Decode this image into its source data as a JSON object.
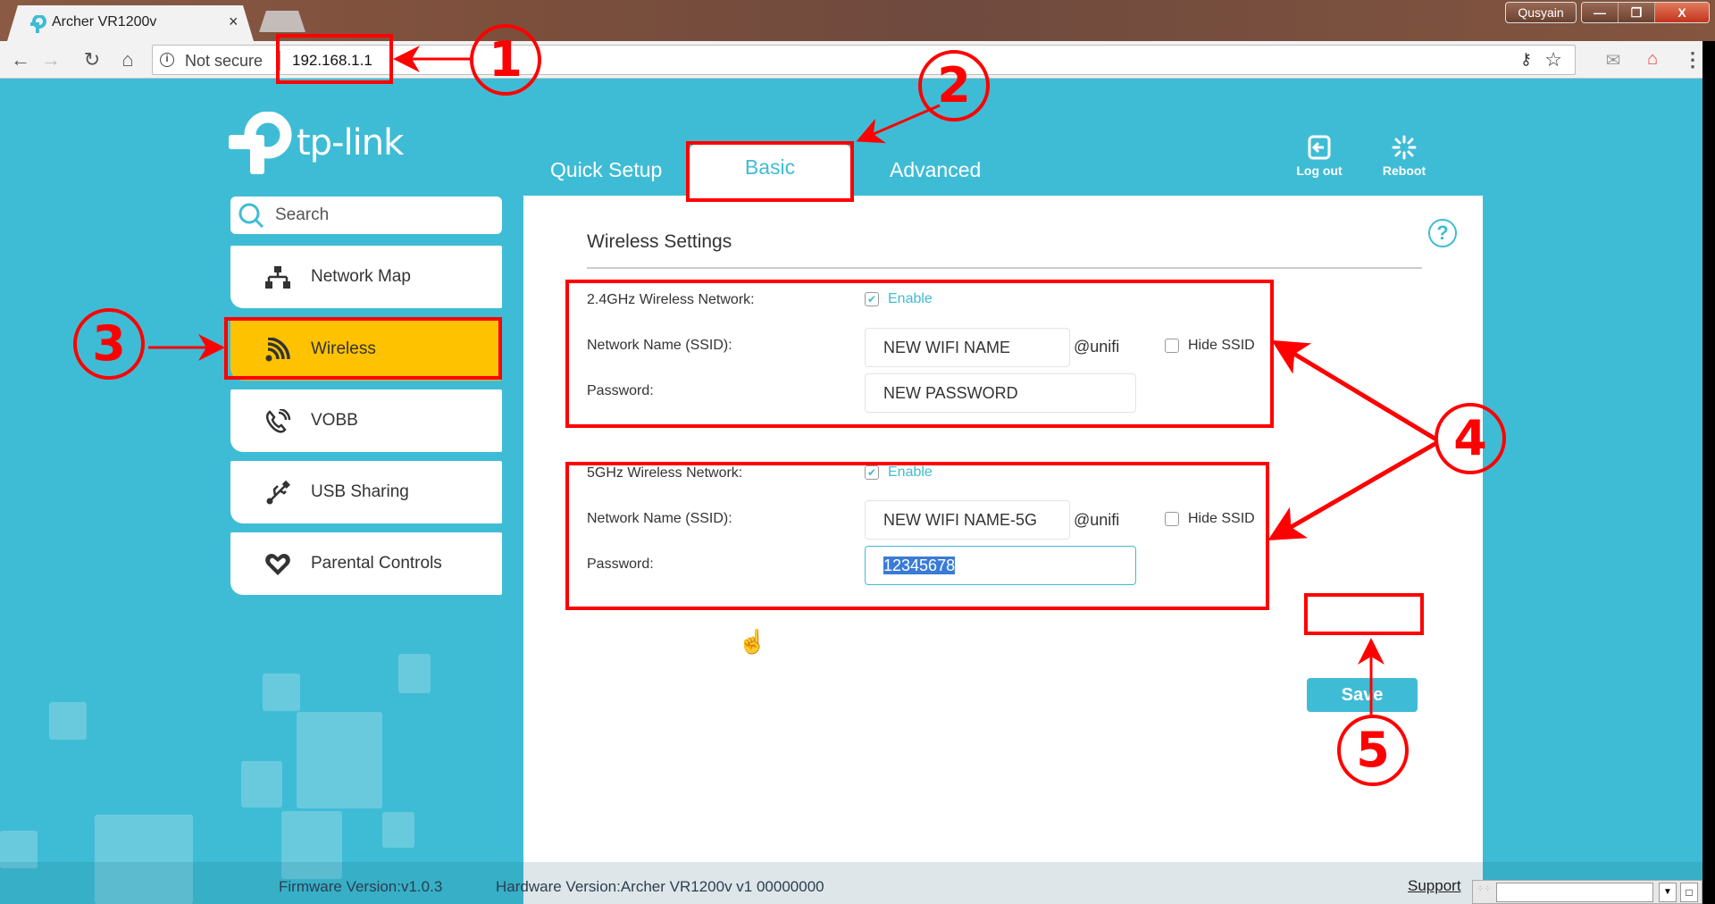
{
  "browser": {
    "tab_title": "Archer VR1200v",
    "tab_close": "×",
    "profile_name": "Qusyain",
    "window_controls": {
      "minimize": "—",
      "restore": "❐",
      "close": "X"
    },
    "security_label": "Not secure",
    "url": "192.168.1.1",
    "icons": [
      "back-icon",
      "forward-icon",
      "reload-icon",
      "home-icon",
      "info-icon",
      "key-icon",
      "star-icon",
      "mail-extension-icon",
      "home-extension-icon",
      "menu-icon"
    ]
  },
  "header": {
    "brand": "tp-link",
    "nav": [
      {
        "label": "Quick Setup",
        "active": false
      },
      {
        "label": "Basic",
        "active": true
      },
      {
        "label": "Advanced",
        "active": false
      }
    ],
    "actions": [
      {
        "label": "Log out",
        "icon": "logout-icon"
      },
      {
        "label": "Reboot",
        "icon": "reboot-icon"
      }
    ]
  },
  "sidebar": {
    "search_placeholder": "Search",
    "items": [
      {
        "label": "Network Map",
        "icon": "network-map-icon",
        "active": false
      },
      {
        "label": "Wireless",
        "icon": "wireless-icon",
        "active": true
      },
      {
        "label": "VOBB",
        "icon": "phone-icon",
        "active": false
      },
      {
        "label": "USB Sharing",
        "icon": "usb-icon",
        "active": false
      },
      {
        "label": "Parental Controls",
        "icon": "heart-icon",
        "active": false
      }
    ]
  },
  "content": {
    "section_title": "Wireless Settings",
    "help": "?",
    "band_24": {
      "network_label": "2.4GHz Wireless Network:",
      "enable_label": "Enable",
      "enabled": true,
      "ssid_label": "Network Name (SSID):",
      "ssid_value": "NEW WIFI NAME",
      "ssid_suffix": "@unifi",
      "hide_ssid_label": "Hide SSID",
      "hide_ssid": false,
      "password_label": "Password:",
      "password_value": "NEW PASSWORD"
    },
    "band_5": {
      "network_label": "5GHz Wireless Network:",
      "enable_label": "Enable",
      "enabled": true,
      "ssid_label": "Network Name (SSID):",
      "ssid_value": "NEW WIFI NAME-5G",
      "ssid_suffix": "@unifi",
      "hide_ssid_label": "Hide SSID",
      "hide_ssid": false,
      "password_label": "Password:",
      "password_value": "12345678"
    },
    "save_label": "Save"
  },
  "footer": {
    "firmware": "Firmware Version:v1.0.3",
    "hardware": "Hardware Version:Archer VR1200v v1 00000000",
    "support": "Support"
  },
  "annotations": {
    "step1": "1",
    "step2": "2",
    "step3": "3",
    "step4": "4",
    "step5": "5",
    "color": "#ff0000"
  },
  "theme": {
    "primary": "#3fbcd5",
    "active_item": "#ffc200",
    "selection": "#3a7bd5"
  }
}
